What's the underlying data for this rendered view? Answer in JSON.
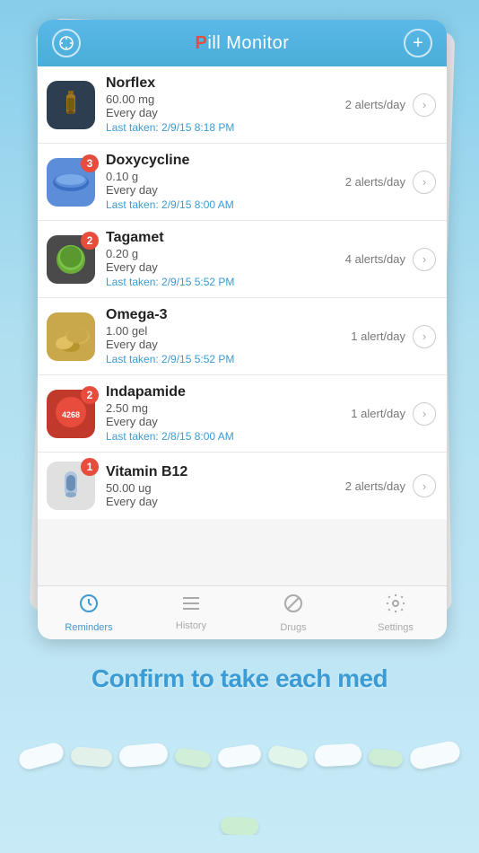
{
  "app": {
    "title_pill": "Pill",
    "title_monitor": " Monitor"
  },
  "header": {
    "left_icon": "compass-icon",
    "right_icon": "add-icon"
  },
  "medications": [
    {
      "name": "Norflex",
      "dose": "60.00 mg",
      "frequency": "Every day",
      "last_taken": "Last taken: 2/9/15 8:18 PM",
      "alerts": "2 alerts/day",
      "badge": null,
      "icon_type": "norflex"
    },
    {
      "name": "Doxycycline",
      "dose": "0.10 g",
      "frequency": "Every day",
      "last_taken": "Last taken: 2/9/15 8:00 AM",
      "alerts": "2 alerts/day",
      "badge": "3",
      "icon_type": "doxy"
    },
    {
      "name": "Tagamet",
      "dose": "0.20 g",
      "frequency": "Every day",
      "last_taken": "Last taken: 2/9/15 5:52 PM",
      "alerts": "4 alerts/day",
      "badge": "2",
      "icon_type": "tagamet"
    },
    {
      "name": "Omega-3",
      "dose": "1.00 gel",
      "frequency": "Every day",
      "last_taken": "Last taken: 2/9/15 5:52 PM",
      "alerts": "1 alert/day",
      "badge": null,
      "icon_type": "omega3"
    },
    {
      "name": "Indapamide",
      "dose": "2.50 mg",
      "frequency": "Every day",
      "last_taken": "Last taken: 2/8/15 8:00 AM",
      "alerts": "1 alert/day",
      "badge": "2",
      "icon_type": "indapamide"
    },
    {
      "name": "Vitamin B12",
      "dose": "50.00 ug",
      "frequency": "Every day",
      "last_taken": null,
      "alerts": "2 alerts/day",
      "badge": "1",
      "icon_type": "vitb12"
    }
  ],
  "tabs": [
    {
      "label": "Reminders",
      "icon": "⏰",
      "active": true
    },
    {
      "label": "History",
      "icon": "≡",
      "active": false
    },
    {
      "label": "Drugs",
      "icon": "⊘",
      "active": false
    },
    {
      "label": "Settings",
      "icon": "⚙",
      "active": false
    }
  ],
  "banner": {
    "text": "Confirm to take each med"
  }
}
